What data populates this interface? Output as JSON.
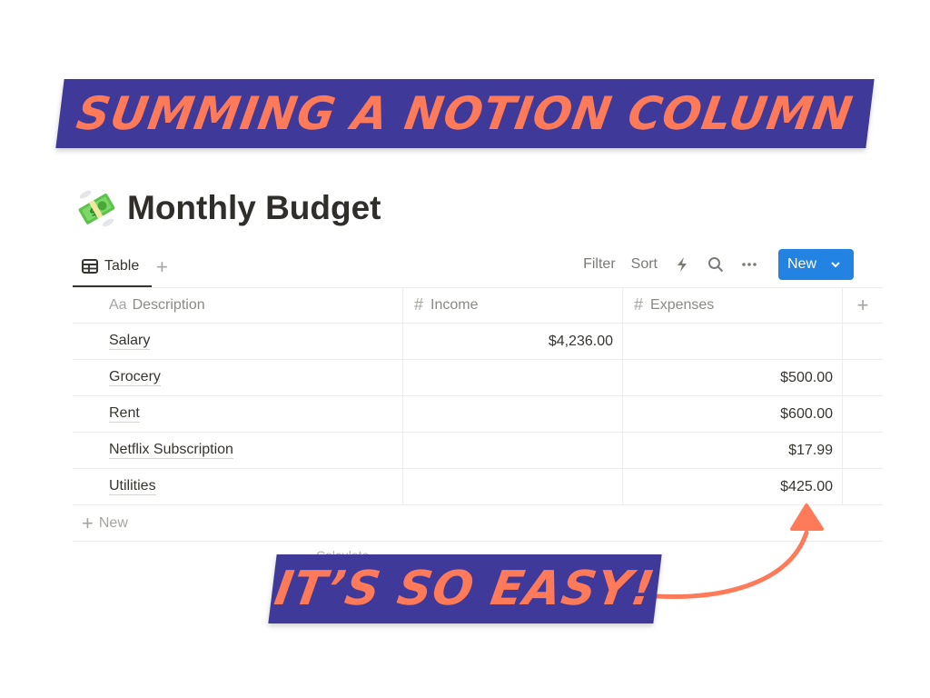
{
  "banners": {
    "top": "SUMMING A NOTION COLUMN",
    "bottom": "IT’S SO EASY!"
  },
  "page": {
    "emoji": "money-with-wings",
    "title": "Monthly Budget"
  },
  "view_bar": {
    "active_tab": "Table",
    "add_view": "+",
    "toolbar": {
      "filter": "Filter",
      "sort": "Sort",
      "automation_icon": "lightning-icon",
      "search_icon": "search-icon",
      "more_icon": "more-icon",
      "new_button": "New"
    }
  },
  "table": {
    "columns": [
      {
        "icon": "Aa",
        "label": "Description"
      },
      {
        "icon": "#",
        "label": "Income"
      },
      {
        "icon": "#",
        "label": "Expenses"
      }
    ],
    "add_column": "+",
    "rows": [
      {
        "description": "Salary",
        "income": "$4,236.00",
        "expenses": ""
      },
      {
        "description": "Grocery",
        "income": "",
        "expenses": "$500.00"
      },
      {
        "description": "Rent",
        "income": "",
        "expenses": "$600.00"
      },
      {
        "description": "Netflix Subscription",
        "income": "",
        "expenses": "$17.99"
      },
      {
        "description": "Utilities",
        "income": "",
        "expenses": "$425.00"
      }
    ],
    "new_row": "New",
    "calculate": "Calculate"
  },
  "colors": {
    "banner_bg": "#3f3a9a",
    "banner_text": "#ff7a59",
    "accent_blue": "#2383e2",
    "arrow": "#ff7a59"
  }
}
